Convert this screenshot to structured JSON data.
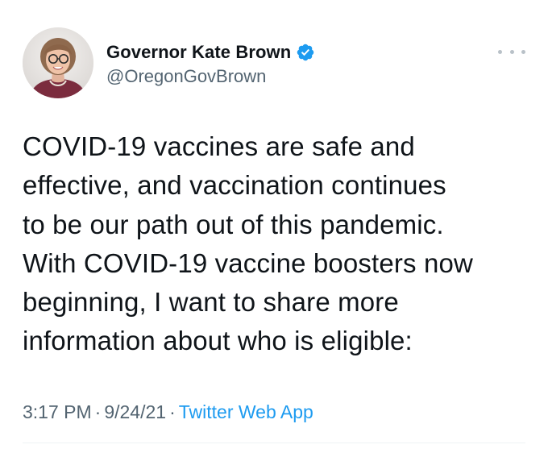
{
  "author": {
    "display_name": "Governor Kate Brown",
    "handle": "@OregonGovBrown",
    "verified_icon": "verified-badge-icon",
    "avatar_icon": "profile-photo"
  },
  "menu": {
    "more_icon": "ellipsis-icon"
  },
  "tweet": {
    "lines": [
      "COVID-19 vaccines are safe and",
      "effective, and vaccination continues",
      "to be our path out of this pandemic.",
      "With COVID-19 vaccine boosters now",
      "beginning, I want to share more",
      "information about who is eligible:"
    ]
  },
  "meta": {
    "time": "3:17 PM",
    "date": "9/24/21",
    "separator": "·",
    "source": "Twitter Web App"
  },
  "colors": {
    "accent": "#1d9bf0",
    "secondary_text": "#536471",
    "primary_text": "#0f1419"
  }
}
